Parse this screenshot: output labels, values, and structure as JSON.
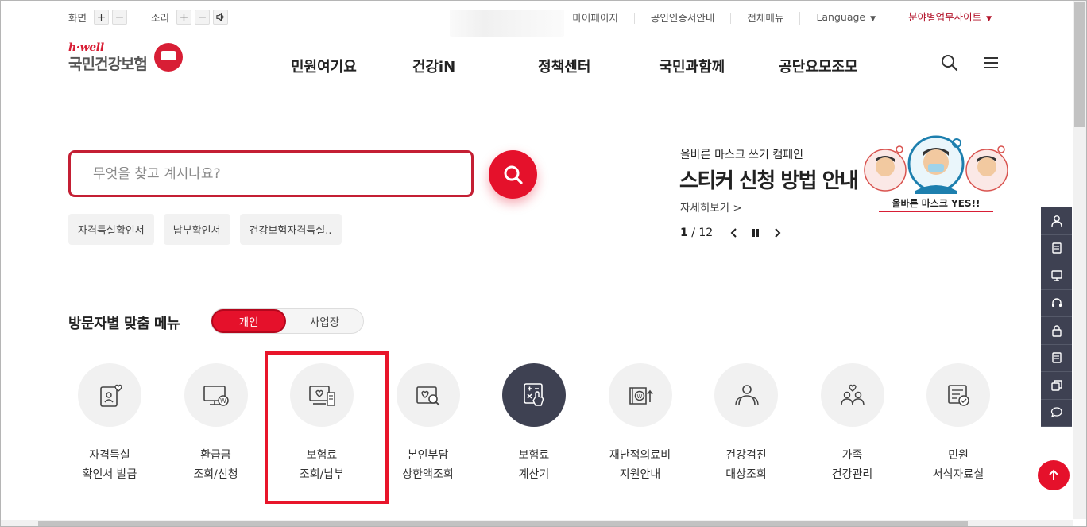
{
  "utility": {
    "screen_label": "화면",
    "sound_label": "소리",
    "plus": "+",
    "minus": "−",
    "links": [
      "마이페이지",
      "공인인증서안내",
      "전체메뉴",
      "Language",
      "분야별업무사이트"
    ]
  },
  "logo": {
    "brand": "h·well",
    "name": "국민건강보험"
  },
  "nav": [
    "민원여기요",
    "건강iN",
    "정책센터",
    "국민과함께",
    "공단요모조모"
  ],
  "search": {
    "placeholder": "무엇을 찾고 계시나요?",
    "chips": [
      "자격득실확인서",
      "납부확인서",
      "건강보험자격득실.."
    ]
  },
  "banner": {
    "subtitle": "올바른 마스크 쓰기 캠페인",
    "title": "스티커 신청 방법 안내",
    "more": "자세히보기 >",
    "page_current": "1",
    "page_total": "/ 12",
    "image_caption": "올바른 마스크 YES!!"
  },
  "persona": {
    "title": "방문자별 맞춤 메뉴",
    "toggle_active": "개인",
    "toggle_inactive": "사업장"
  },
  "menu_items": [
    {
      "line1": "자격득실",
      "line2": "확인서 발급",
      "icon": "id-card-heart-icon"
    },
    {
      "line1": "환급금",
      "line2": "조회/신청",
      "icon": "monitor-won-icon"
    },
    {
      "line1": "보험료",
      "line2": "조회/납부",
      "icon": "bill-heart-icon"
    },
    {
      "line1": "본인부담",
      "line2": "상한액조회",
      "icon": "heart-search-icon"
    },
    {
      "line1": "보험료",
      "line2": "계산기",
      "icon": "calculator-icon"
    },
    {
      "line1": "재난적의료비",
      "line2": "지원안내",
      "icon": "won-card-icon"
    },
    {
      "line1": "건강검진",
      "line2": "대상조회",
      "icon": "people-icon"
    },
    {
      "line1": "가족",
      "line2": "건강관리",
      "icon": "family-heart-icon"
    },
    {
      "line1": "민원",
      "line2": "서식자료실",
      "icon": "document-check-icon"
    }
  ],
  "colors": {
    "brand_red": "#e5112b",
    "dark_navy": "#3e4152",
    "highlight": "#e8152a"
  }
}
